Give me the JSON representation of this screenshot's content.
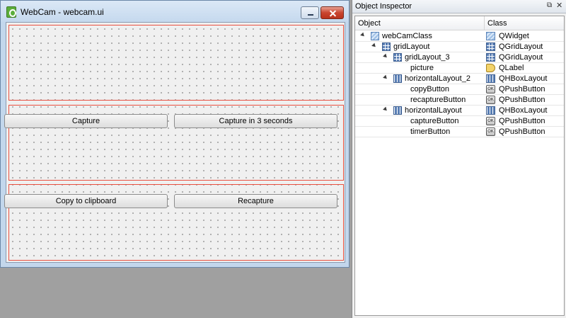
{
  "form_window": {
    "title": "WebCam - webcam.ui",
    "buttons": {
      "capture": "Capture",
      "capture_delayed": "Capture in 3 seconds",
      "copy": "Copy to clipboard",
      "recapture": "Recapture"
    }
  },
  "inspector": {
    "title": "Object Inspector",
    "columns": {
      "object": "Object",
      "class": "Class"
    },
    "rows": [
      {
        "object": "webCamClass",
        "class": "QWidget",
        "icon": "widget-icon"
      },
      {
        "object": "gridLayout",
        "class": "QGridLayout",
        "icon": "grid-layout-icon"
      },
      {
        "object": "gridLayout_3",
        "class": "QGridLayout",
        "icon": "grid-layout-icon"
      },
      {
        "object": "picture",
        "class": "QLabel",
        "icon": "label-icon"
      },
      {
        "object": "horizontalLayout_2",
        "class": "QHBoxLayout",
        "icon": "hbox-layout-icon"
      },
      {
        "object": "copyButton",
        "class": "QPushButton",
        "icon": "push-button-icon"
      },
      {
        "object": "recaptureButton",
        "class": "QPushButton",
        "icon": "push-button-icon"
      },
      {
        "object": "horizontalLayout",
        "class": "QHBoxLayout",
        "icon": "hbox-layout-icon"
      },
      {
        "object": "captureButton",
        "class": "QPushButton",
        "icon": "push-button-icon"
      },
      {
        "object": "timerButton",
        "class": "QPushButton",
        "icon": "push-button-icon"
      }
    ],
    "push_icon_text": "OK"
  },
  "colors": {
    "layout_border": "#e85040",
    "workspace": "#a0a0a0",
    "window_frame": "#c3d7ec"
  }
}
